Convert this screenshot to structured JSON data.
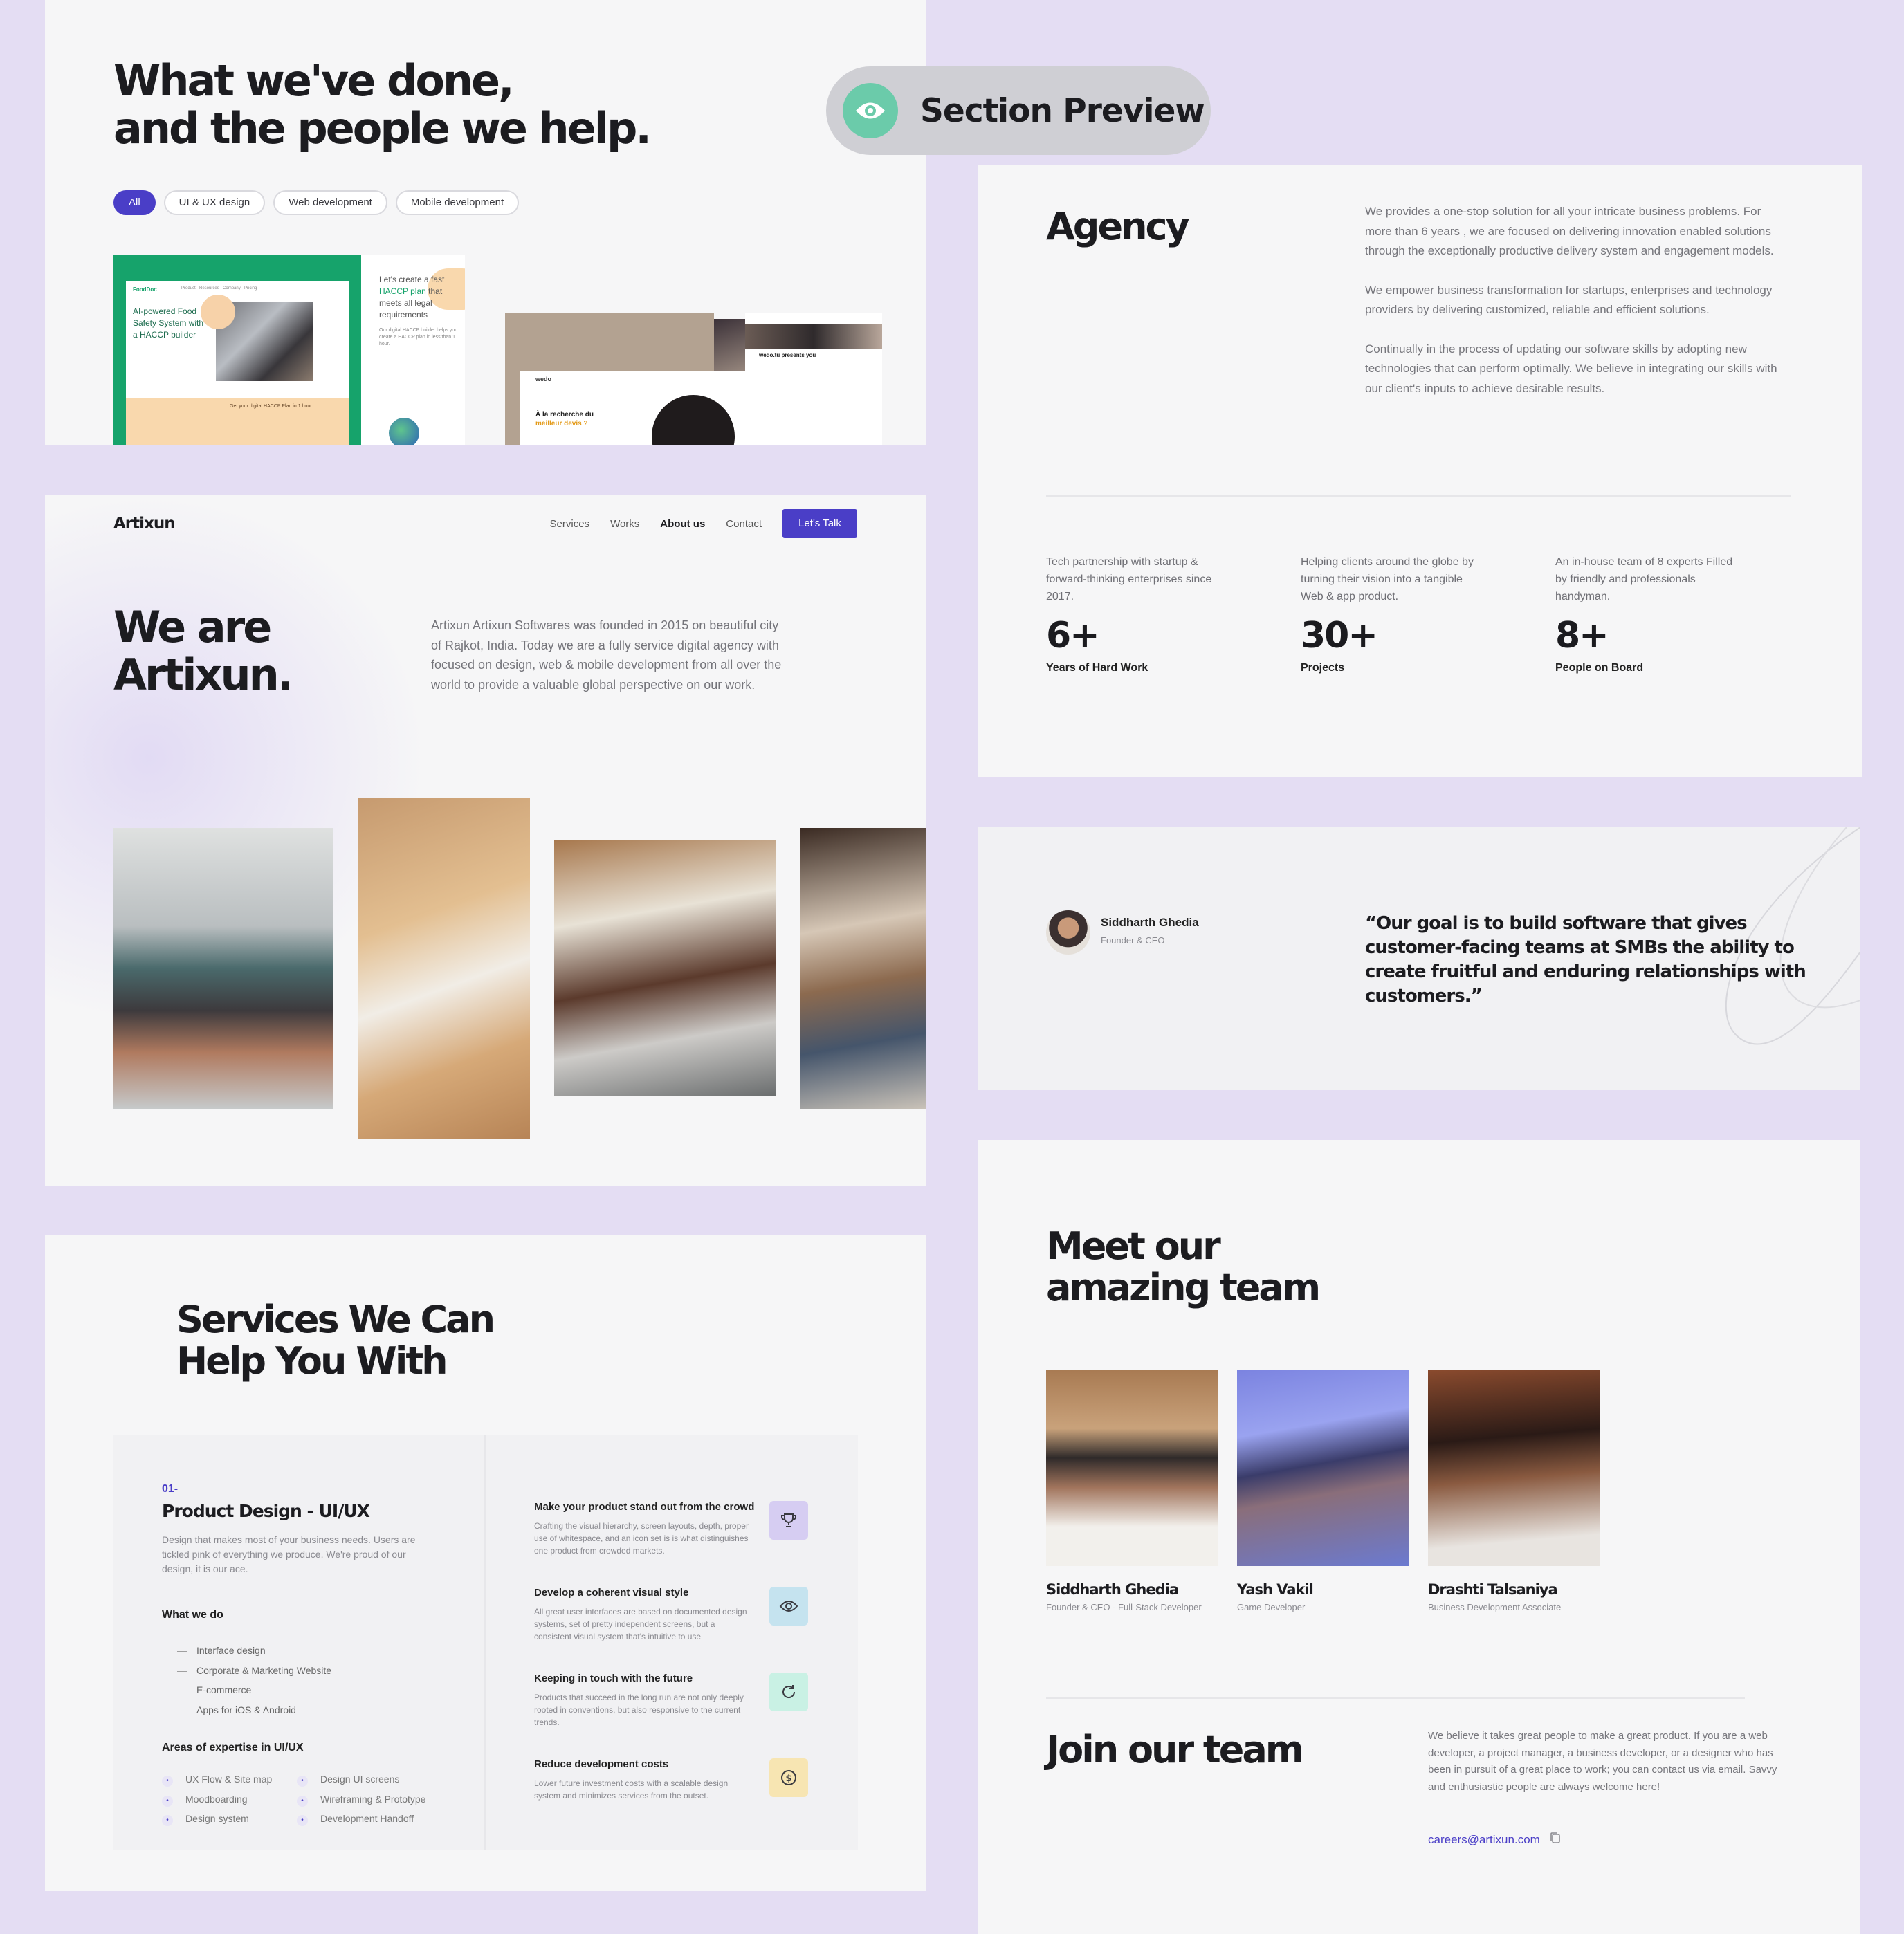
{
  "work": {
    "heading_line1": "What we've done,",
    "heading_line2": "and the people we help.",
    "filters": [
      "All",
      "UI & UX design",
      "Web development",
      "Mobile development"
    ],
    "thumb1": {
      "brand": "FoodDoc",
      "nav": "Product · Resources · Company · Pricing",
      "headline": "AI-powered Food Safety System with a HACCP builder",
      "cta": "Get your digital HACCP Plan in 1 hour"
    },
    "thumb2": {
      "headline_a": "Let's create a fast",
      "headline_b": "HACCP plan",
      "headline_c": "that meets all legal requirements",
      "body": "Our digital HACCP builder helps you create a HACCP plan in less than 1 hour."
    },
    "thumb3": {
      "brand": "wedo",
      "headline_a": "À la recherche du",
      "headline_b": "meilleur devis ?",
      "side_title": "wedo.tu presents you"
    }
  },
  "preview_badge": {
    "label": "Section Preview",
    "icon": "eye-icon"
  },
  "about": {
    "logo": "Artixun",
    "nav": [
      "Services",
      "Works",
      "About us",
      "Contact"
    ],
    "cta": "Let's Talk",
    "heading_line1": "We are",
    "heading_line2": "Artixun.",
    "intro": "Artixun Artixun Softwares was founded in 2015 on beautiful city of Rajkot, India. Today we are a fully service digital agency with focused on design, web & mobile development from all over the world to provide a valuable global perspective on our work."
  },
  "agency": {
    "title": "Agency",
    "paragraphs": [
      "We provides a one-stop solution for all your intricate business problems. For more than 6 years , we are focused on delivering innovation enabled solutions through the exceptionally productive delivery system and engagement models.",
      "We empower business transformation for startups, enterprises and technology providers by delivering customized, reliable and efficient solutions.",
      "Continually in the process of updating our software skills by adopting new technologies that can perform optimally. We believe in integrating our skills with our client's inputs to achieve desirable results."
    ],
    "stats": [
      {
        "desc": "Tech partnership with startup & forward-thinking enterprises since 2017.",
        "value": "6+",
        "label": "Years of Hard Work"
      },
      {
        "desc": "Helping clients around the globe by turning their vision into a tangible Web & app product.",
        "value": "30+",
        "label": "Projects"
      },
      {
        "desc": "An in-house team of 8 experts Filled by friendly and professionals handyman.",
        "value": "8+",
        "label": "People on Board"
      }
    ]
  },
  "quote": {
    "name": "Siddharth Ghedia",
    "role": "Founder & CEO",
    "text": "“Our goal is to build software that gives customer-facing teams at SMBs the ability to create fruitful and enduring relationships with customers.”"
  },
  "services": {
    "heading_line1": "Services We Can",
    "heading_line2": "Help You With",
    "number": "01-",
    "title": "Product Design - UI/UX",
    "desc": "Design that makes most of your business needs. Users are tickled pink of everything we produce. We're proud of our design, it is our ace.",
    "what_we_do_title": "What we do",
    "what_we_do": [
      "Interface design",
      "Corporate & Marketing Website",
      "E-commerce",
      "Apps for iOS & Android"
    ],
    "expertise_title": "Areas of expertise in UI/UX",
    "expertise_col1": [
      "UX Flow & Site map",
      "Moodboarding",
      "Design system"
    ],
    "expertise_col2": [
      "Design UI screens",
      "Wireframing & Prototype",
      "Development Handoff"
    ],
    "features": [
      {
        "title": "Make your product stand out from the crowd",
        "text": "Crafting the visual hierarchy, screen layouts, depth, proper use of whitespace, and an icon set is is what distinguishes one product from crowded markets.",
        "icon": "trophy-icon",
        "color": "#d6cdf2"
      },
      {
        "title": "Develop a coherent visual style",
        "text": "All great user interfaces are based on documented design systems, set of pretty independent screens, but a consistent visual system that's intuitive to use",
        "icon": "eye-icon",
        "color": "#c5e3ef"
      },
      {
        "title": "Keeping in touch with the future",
        "text": "Products that succeed in the long run are not only deeply rooted in conventions, but also responsive to the current trends.",
        "icon": "refresh-icon",
        "color": "#c9f1e4"
      },
      {
        "title": "Reduce development costs",
        "text": "Lower future investment costs with a scalable design system and minimizes services from the outset.",
        "icon": "dollar-icon",
        "color": "#f7e5b2"
      }
    ]
  },
  "team": {
    "heading_line1": "Meet our",
    "heading_line2": "amazing team",
    "members": [
      {
        "name": "Siddharth Ghedia",
        "role": "Founder & CEO - Full-Stack Developer"
      },
      {
        "name": "Yash Vakil",
        "role": "Game Developer"
      },
      {
        "name": "Drashti Talsaniya",
        "role": "Business Development Associate"
      }
    ],
    "join_title": "Join our team",
    "join_text": "We believe it takes great people to make a great product. If you are a web developer, a project manager, a business developer, or a designer who has been in pursuit of a great place to work; you can contact us via email. Savvy and enthusiastic people are always welcome here!",
    "email": "careers@artixun.com"
  },
  "colors": {
    "accent": "#4a3ec7",
    "background": "#e4ddf3",
    "fooddoc_green": "#16a36b"
  }
}
